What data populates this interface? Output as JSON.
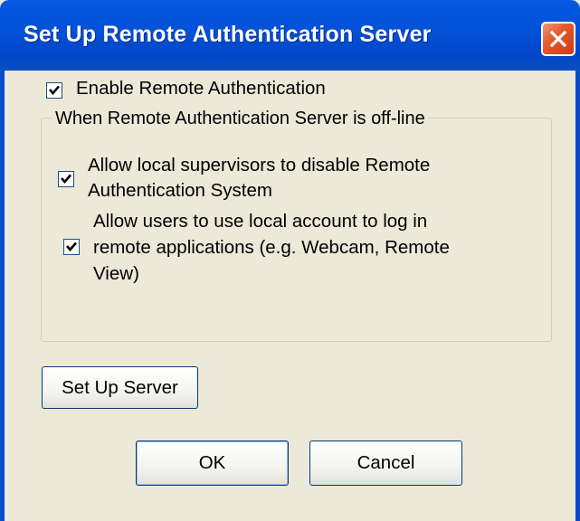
{
  "dialog": {
    "title": "Set Up Remote Authentication Server",
    "enable_remote_auth": {
      "label": "Enable Remote Authentication",
      "checked": true
    },
    "offline_group": {
      "legend": "When Remote Authentication Server is off-line",
      "allow_supervisors": {
        "label_line1": "Allow local supervisors to disable Remote",
        "label_line2": "Authentication System",
        "checked": true
      },
      "allow_local_accounts": {
        "label_line1": "Allow users to use local account to log in",
        "label_line2": "remote applications (e.g. Webcam, Remote",
        "label_line3": "View)",
        "checked": true
      }
    },
    "setup_server_label": "Set Up Server",
    "ok_label": "OK",
    "cancel_label": "Cancel"
  },
  "icons": {
    "close": "close-icon",
    "check": "checkmark-icon"
  },
  "colors": {
    "titlebar": "#0351d7",
    "close": "#e55a2f",
    "face": "#ece9d8"
  }
}
